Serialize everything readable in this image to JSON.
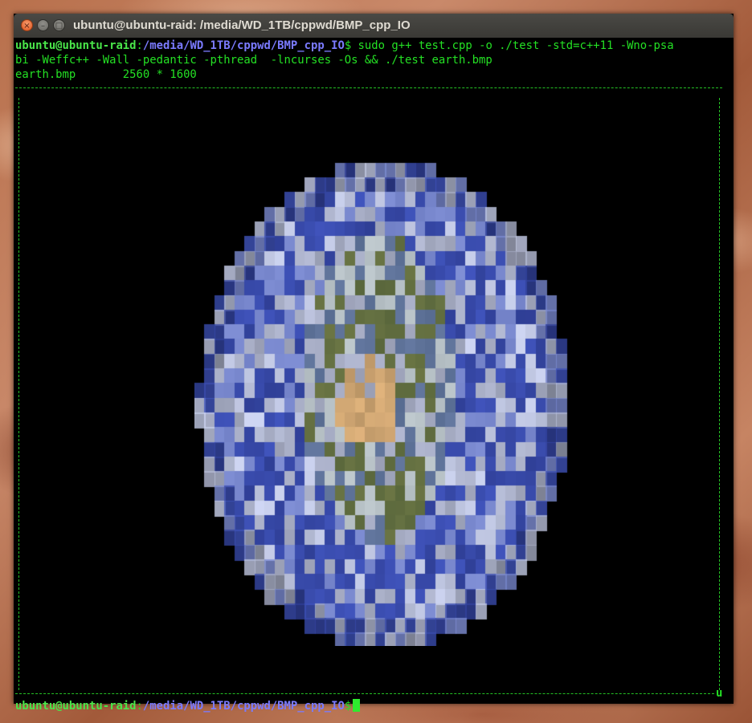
{
  "window": {
    "title": "ubuntu@ubuntu-raid: /media/WD_1TB/cppwd/BMP_cpp_IO",
    "buttons": {
      "close": "×",
      "minimize": "–",
      "maximize": "□"
    }
  },
  "terminal": {
    "prompt_user": "ubuntu@ubuntu-raid",
    "prompt_sep": ":",
    "prompt_path": "/media/WD_1TB/cppwd/BMP_cpp_IO",
    "prompt_symbol": "$",
    "command_line1": " sudo g++ test.cpp -o ./test -std=c++11 -Wno-psa",
    "command_line2": "bi -Weffc++ -Wall -pedantic -pthread  -lncurses -Os && ./test earth.bmp",
    "output_line": "earth.bmp       2560 * 1600",
    "corner_char": "u"
  },
  "image": {
    "name": "earth.bmp",
    "dominant_colors": [
      "#3d4f9e",
      "#8e98c8",
      "#5e6b3a",
      "#b5926a",
      "#14183a"
    ]
  }
}
